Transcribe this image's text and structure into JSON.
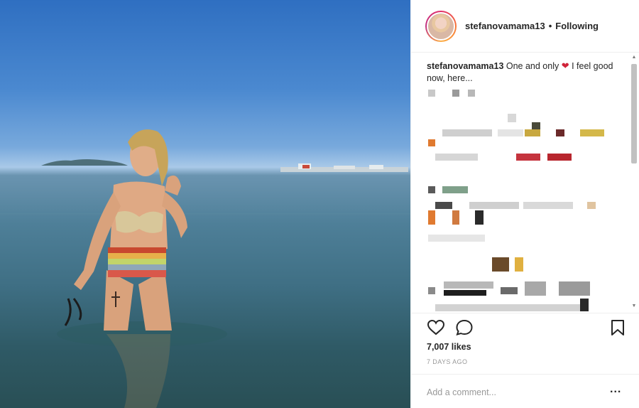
{
  "post": {
    "username": "stefanovamama13",
    "follow_state": "Following",
    "dot": "•",
    "caption_before": " One and only ",
    "caption_emoji": "❤",
    "caption_after": " I feel good now, here...",
    "likes": "7,007 likes",
    "time": "7 DAYS AGO"
  },
  "comment": {
    "placeholder": "Add a comment...",
    "more": "..."
  },
  "icons": {
    "like": "heart-outline-icon",
    "comment": "speech-bubble-icon",
    "save": "bookmark-icon",
    "scroll_up": "▲",
    "scroll_down": "▼"
  },
  "colors": {
    "border": "#efefef",
    "text": "#262626",
    "muted": "#999999",
    "heart": "#d0243a"
  }
}
